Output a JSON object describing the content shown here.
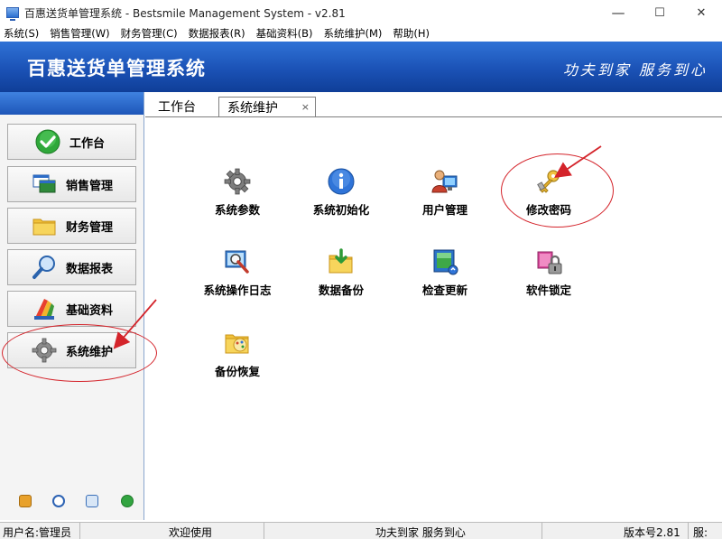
{
  "window": {
    "title": "百惠送货单管理系统 - Bestsmile Management System - v2.81",
    "controls": {
      "minimize": "—",
      "maximize": "☐",
      "close": "✕"
    }
  },
  "menu": [
    "系统(S)",
    "销售管理(W)",
    "财务管理(C)",
    "数据报表(R)",
    "基础资料(B)",
    "系统维护(M)",
    "帮助(H)"
  ],
  "banner": {
    "title": "百惠送货单管理系统",
    "slogan": "功夫到家 服务到心"
  },
  "sidebar": {
    "items": [
      {
        "label": "工作台",
        "icon": "check-icon"
      },
      {
        "label": "销售管理",
        "icon": "windows-icon"
      },
      {
        "label": "财务管理",
        "icon": "folder-icon"
      },
      {
        "label": "数据报表",
        "icon": "magnifier-icon"
      },
      {
        "label": "基础资料",
        "icon": "color-swatch-icon"
      },
      {
        "label": "系统维护",
        "icon": "gear-icon"
      }
    ],
    "bottom_icons": [
      "key-icon",
      "clock-icon",
      "find-icon",
      "back-arrow-icon"
    ]
  },
  "tabs": {
    "plain": "工作台",
    "active": "系统维护",
    "close": "×"
  },
  "tiles": [
    {
      "label": "系统参数",
      "icon": "gear-icon"
    },
    {
      "label": "系统初始化",
      "icon": "info-icon"
    },
    {
      "label": "用户管理",
      "icon": "user-monitor-icon"
    },
    {
      "label": "修改密码",
      "icon": "keys-icon"
    },
    {
      "label": "系统操作日志",
      "icon": "log-magnifier-icon"
    },
    {
      "label": "数据备份",
      "icon": "folder-download-icon"
    },
    {
      "label": "检查更新",
      "icon": "update-icon"
    },
    {
      "label": "软件锁定",
      "icon": "lock-icon"
    },
    {
      "label": "备份恢复",
      "icon": "folder-restore-icon"
    }
  ],
  "status": {
    "user": "用户名:管理员",
    "welcome": "欢迎使用",
    "slogan": "功夫到家 服务到心",
    "version": "版本号2.81",
    "extra": "服:"
  },
  "colors": {
    "banner": "#1b52b6",
    "annotation": "#d4242b"
  }
}
